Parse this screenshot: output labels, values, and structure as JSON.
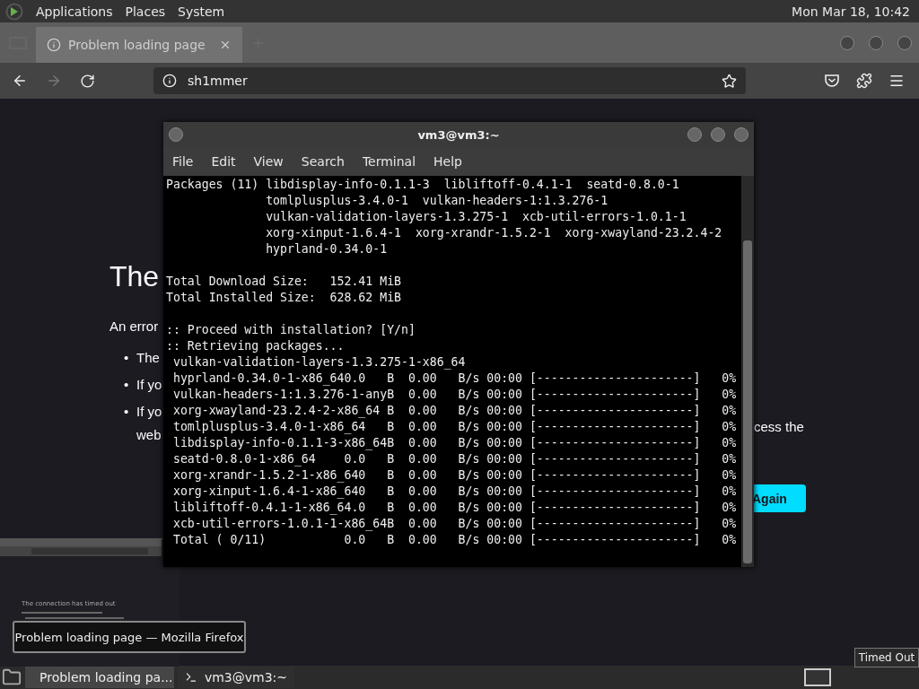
{
  "top_panel": {
    "menus": [
      "Applications",
      "Places",
      "System"
    ],
    "clock": "Mon Mar 18, 10:42"
  },
  "browser": {
    "tab": {
      "title": "Problem loading page",
      "selected": true
    },
    "forward_button": {
      "disabled": true
    },
    "url": "sh1mmer",
    "page": {
      "heading": "The",
      "intro": "An error",
      "bullets": [
        {
          "marker": "•",
          "text": "The"
        },
        {
          "marker": "•",
          "text": "If yo"
        },
        {
          "marker": "•",
          "text": "If yo"
        }
      ],
      "bullet_continuation": "web",
      "side_text": "cess the",
      "button": "Again"
    }
  },
  "terminal": {
    "title": "vm3@vm3:~",
    "menu": [
      "File",
      "Edit",
      "View",
      "Search",
      "Terminal",
      "Help"
    ],
    "blocks": [
      [
        "Packages (11) libdisplay-info-0.1.1-3  libliftoff-0.4.1-1  seatd-0.8.0-1",
        "              tomlplusplus-3.4.0-1  vulkan-headers-1:1.3.276-1",
        "              vulkan-validation-layers-1.3.275-1  xcb-util-errors-1.0.1-1",
        "              xorg-xinput-1.6.4-1  xorg-xrandr-1.5.2-1  xorg-xwayland-23.2.4-2",
        "              hyprland-0.34.0-1"
      ],
      [
        "Total Download Size:   152.41 MiB",
        "Total Installed Size:  628.62 MiB"
      ],
      [
        ":: Proceed with installation? [Y/n]",
        ":: Retrieving packages...",
        " vulkan-validation-layers-1.3.275-1-x86_64",
        " hyprland-0.34.0-1-x86_640.0   B  0.00   B/s 00:00 [----------------------]   0%",
        " vulkan-headers-1:1.3.276-1-anyB  0.00   B/s 00:00 [----------------------]   0%",
        " xorg-xwayland-23.2.4-2-x86_64 B  0.00   B/s 00:00 [----------------------]   0%",
        " tomlplusplus-3.4.0-1-x86_64   B  0.00   B/s 00:00 [----------------------]   0%",
        " libdisplay-info-0.1.1-3-x86_64B  0.00   B/s 00:00 [----------------------]   0%",
        " seatd-0.8.0-1-x86_64    0.0   B  0.00   B/s 00:00 [----------------------]   0%",
        " xorg-xrandr-1.5.2-1-x86_640   B  0.00   B/s 00:00 [----------------------]   0%",
        " xorg-xinput-1.6.4-1-x86_640   B  0.00   B/s 00:00 [----------------------]   0%",
        " libliftoff-0.4.1-1-x86_64.0   B  0.00   B/s 00:00 [----------------------]   0%",
        " xcb-util-errors-1.0.1-1-x86_64B  0.00   B/s 00:00 [----------------------]   0%",
        " Total ( 0/11)           0.0   B  0.00   B/s 00:00 [----------------------]   0%"
      ]
    ]
  },
  "window_preview": {
    "heading": "The connection has timed out"
  },
  "tooltip": "Problem loading page — Mozilla Firefox",
  "taskbar": {
    "tasks": [
      {
        "kind": "browser",
        "label": "Problem loading pa...",
        "selected": true
      },
      {
        "kind": "terminal",
        "label": "vm3@vm3:~",
        "selected": false
      }
    ],
    "notification": "Timed Out"
  }
}
